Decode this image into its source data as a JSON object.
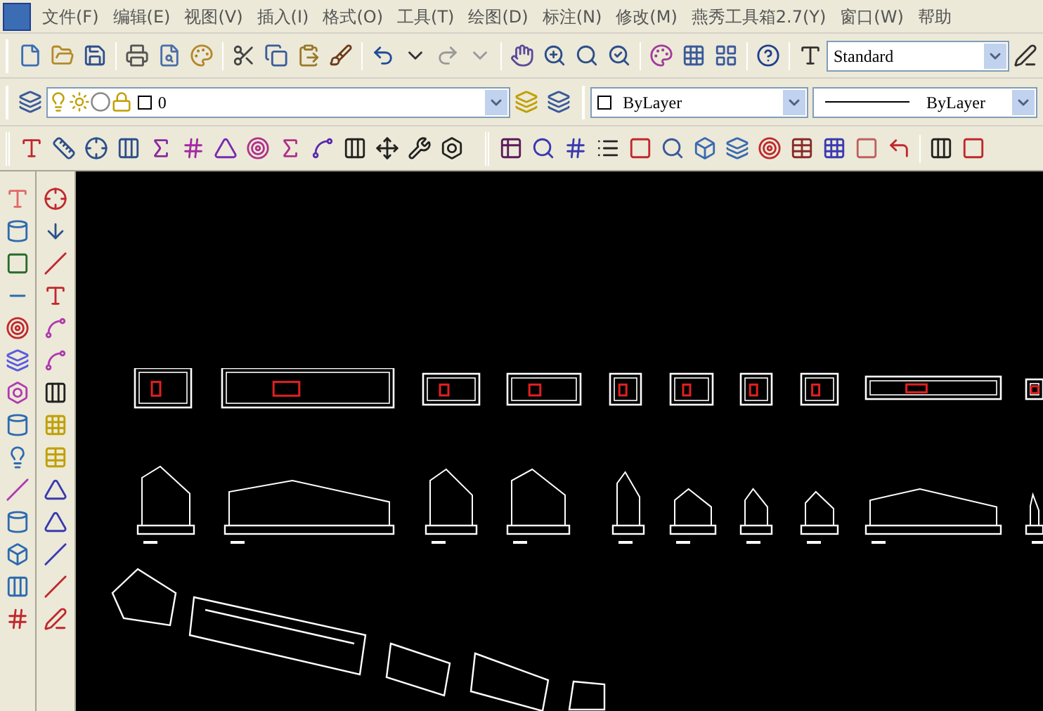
{
  "menu_bar": {
    "items": [
      {
        "label": "文件(F)"
      },
      {
        "label": "编辑(E)"
      },
      {
        "label": "视图(V)"
      },
      {
        "label": "插入(I)"
      },
      {
        "label": "格式(O)"
      },
      {
        "label": "工具(T)"
      },
      {
        "label": "绘图(D)"
      },
      {
        "label": "标注(N)"
      },
      {
        "label": "修改(M)"
      },
      {
        "label": "燕秀工具箱2.7(Y)"
      },
      {
        "label": "窗口(W)"
      },
      {
        "label": "帮助"
      }
    ]
  },
  "styles_toolbar": {
    "text_style": {
      "value": "Standard"
    }
  },
  "layers_toolbar": {
    "layer": {
      "value": "0"
    }
  },
  "properties_toolbar": {
    "color": {
      "value": "ByLayer"
    },
    "linetype": {
      "value": "ByLayer"
    }
  }
}
